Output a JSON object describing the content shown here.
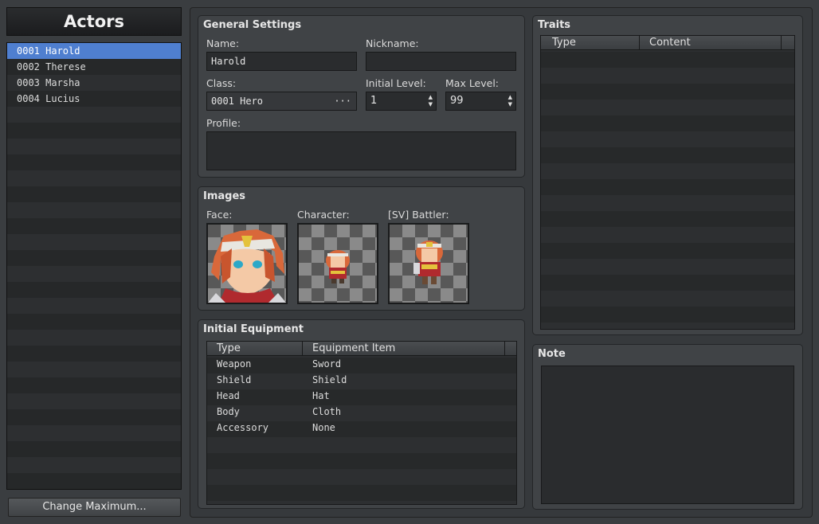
{
  "sidebar": {
    "title": "Actors",
    "actors": [
      {
        "label": "0001 Harold",
        "selected": true
      },
      {
        "label": "0002 Therese",
        "selected": false
      },
      {
        "label": "0003 Marsha",
        "selected": false
      },
      {
        "label": "0004 Lucius",
        "selected": false
      }
    ],
    "change_max_label": "Change Maximum..."
  },
  "general": {
    "title": "General Settings",
    "name_label": "Name:",
    "name_value": "Harold",
    "nickname_label": "Nickname:",
    "nickname_value": "",
    "class_label": "Class:",
    "class_value": "0001 Hero",
    "class_button": "···",
    "initial_level_label": "Initial Level:",
    "initial_level_value": "1",
    "max_level_label": "Max Level:",
    "max_level_value": "99",
    "profile_label": "Profile:",
    "profile_value": ""
  },
  "images": {
    "title": "Images",
    "face_label": "Face:",
    "character_label": "Character:",
    "battler_label": "[SV] Battler:"
  },
  "equipment": {
    "title": "Initial Equipment",
    "columns": [
      "Type",
      "Equipment Item"
    ],
    "rows": [
      {
        "type": "Weapon",
        "item": "Sword"
      },
      {
        "type": "Shield",
        "item": "Shield"
      },
      {
        "type": "Head",
        "item": "Hat"
      },
      {
        "type": "Body",
        "item": "Cloth"
      },
      {
        "type": "Accessory",
        "item": "None"
      }
    ]
  },
  "traits": {
    "title": "Traits",
    "columns": [
      "Type",
      "Content"
    ]
  },
  "note": {
    "title": "Note",
    "value": ""
  },
  "colors": {
    "selection": "#4f7fd0",
    "panel": "#404346",
    "background": "#3a3d40"
  }
}
